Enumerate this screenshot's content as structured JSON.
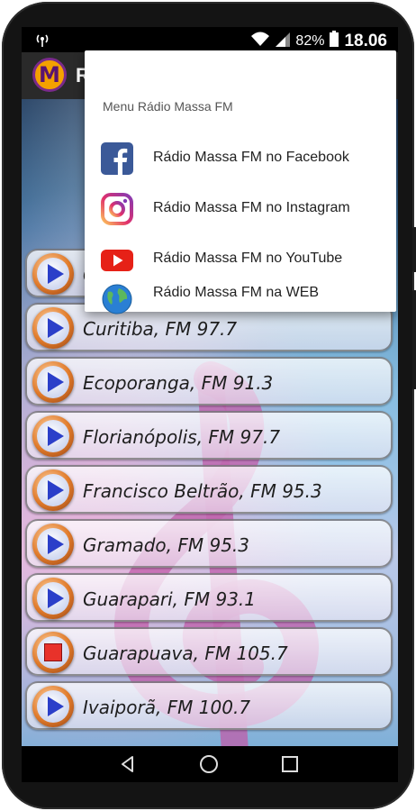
{
  "status": {
    "battery": "82%",
    "time": "18.06",
    "icons": [
      "broadcast-icon",
      "wifi-icon",
      "signal-icon",
      "battery-icon"
    ]
  },
  "app": {
    "logo_letter": "M",
    "title_fragment": "R"
  },
  "menu": {
    "title": "Menu Rádio Massa FM",
    "items": [
      {
        "label": "Rádio Massa FM no Facebook",
        "icon": "facebook-icon",
        "color": "#3b5998"
      },
      {
        "label": "Rádio Massa FM no Instagram",
        "icon": "instagram-icon",
        "color": "#c13584"
      },
      {
        "label": "Rádio Massa FM no YouTube",
        "icon": "youtube-icon",
        "color": "#e62117"
      },
      {
        "label": "Rádio Massa FM na WEB",
        "icon": "globe-icon",
        "color": "#2a7fd4"
      }
    ]
  },
  "stations": [
    {
      "label": "C",
      "state": "play"
    },
    {
      "label": "Curitiba, FM 97.7",
      "state": "play"
    },
    {
      "label": "Ecoporanga, FM 91.3",
      "state": "play"
    },
    {
      "label": "Florianópolis, FM 97.7",
      "state": "play"
    },
    {
      "label": "Francisco Beltrão, FM 95.3",
      "state": "play"
    },
    {
      "label": "Gramado, FM 95.3",
      "state": "play"
    },
    {
      "label": "Guarapari, FM 93.1",
      "state": "play"
    },
    {
      "label": "Guarapuava, FM 105.7",
      "state": "stop"
    },
    {
      "label": "Ivaiporã, FM 100.7",
      "state": "play"
    }
  ],
  "nav": [
    "back-icon",
    "home-icon",
    "recents-icon"
  ]
}
